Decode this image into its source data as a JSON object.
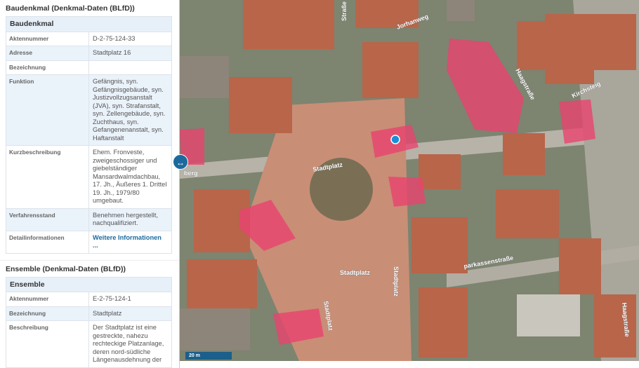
{
  "baudenkmal": {
    "section_title": "Baudenkmal (Denkmal-Daten (BLfD))",
    "table_header": "Baudenkmal",
    "rows": [
      {
        "label": "Aktennummer",
        "value": "D-2-75-124-33"
      },
      {
        "label": "Adresse",
        "value": "Stadtplatz 16"
      },
      {
        "label": "Bezeichnung",
        "value": ""
      },
      {
        "label": "Funktion",
        "value": "Gefängnis, syn. Gefängnisgebäude, syn. Justizvollzugsanstalt (JVA), syn. Strafanstalt, syn. Zellengebäude, syn. Zuchthaus, syn. Gefangenenanstalt, syn. Haftanstalt"
      },
      {
        "label": "Kurzbeschreibung",
        "value": "Ehem. Fronveste, zweigeschossiger und giebelständiger Mansardwalmdachbau, 17. Jh., Äußeres 1. Drittel 19. Jh., 1979/80 umgebaut."
      },
      {
        "label": "Verfahrensstand",
        "value": "Benehmen hergestellt, nachqualifiziert."
      },
      {
        "label": "Detailinformationen",
        "value": "Weitere Informationen ..."
      }
    ]
  },
  "ensemble": {
    "section_title": "Ensemble (Denkmal-Daten (BLfD))",
    "table_header": "Ensemble",
    "rows": [
      {
        "label": "Aktennummer",
        "value": "E-2-75-124-1"
      },
      {
        "label": "Bezeichnung",
        "value": "Stadtplatz"
      },
      {
        "label": "Beschreibung",
        "value": "Der Stadtplatz ist eine gestreckte, nahezu rechteckige Platzanlage, deren nord-südliche Längenausdehnung der"
      }
    ]
  },
  "map": {
    "streets": [
      "Straße",
      "Jorhanweg",
      "Haagstraße",
      "Kirchsteig",
      "Stadtplatz",
      "Stadtplatz",
      "Stadtplatz",
      "Stadtplatz",
      "berg",
      "parkassenstraße",
      "Haagstraße"
    ],
    "scale": "20 m",
    "highlight_color": "#e8436f"
  },
  "toggle_icon": "↔"
}
